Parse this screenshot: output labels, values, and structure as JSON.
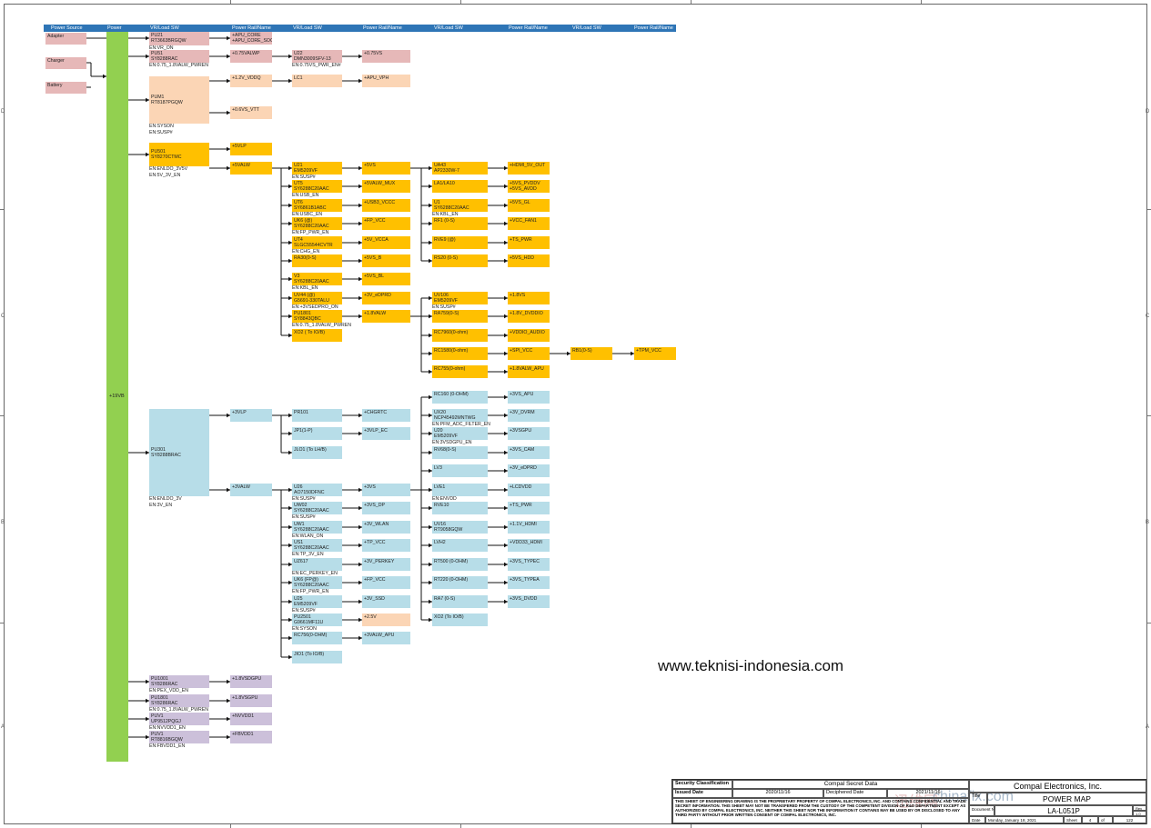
{
  "header": {
    "columns": [
      "Power Source",
      "Power",
      "VR/Load SW",
      "Power Rail/Name",
      "VR/Load SW",
      "Power Rail/Name",
      "VR/Load SW",
      "Power Rail/Name",
      "VR/Load SW",
      "Power Rail/Name"
    ]
  },
  "sources": [
    "Adapter",
    "Charger",
    "Battery"
  ],
  "main_rail": "+19VB",
  "zones": {
    "left": [
      "D",
      "C",
      "B",
      "A"
    ],
    "right": [
      "D",
      "C",
      "B",
      "A"
    ]
  },
  "boxes": [
    {
      "id": "pu21",
      "color": "pink",
      "lines": [
        "PU21",
        "RT3663BRGQW"
      ],
      "sub": [
        "EN:VR_ON"
      ]
    },
    {
      "id": "apu_core",
      "color": "pink",
      "lines": [
        "+APU_CORE",
        "+APU_CORE_SOC"
      ]
    },
    {
      "id": "pu51",
      "color": "pink",
      "lines": [
        "PU51",
        "SY8288RAC"
      ],
      "sub": [
        "EN:0.75_1.8VALW_PWREN"
      ]
    },
    {
      "id": "v075alwp",
      "color": "pink",
      "lines": [
        "+0.75VALWP"
      ]
    },
    {
      "id": "u22",
      "color": "pink",
      "lines": [
        "U22",
        "DMN3009SFV-13"
      ],
      "sub": [
        "EN:0.75VS_PWR_EN#"
      ]
    },
    {
      "id": "v075s",
      "color": "pink",
      "lines": [
        "+0.75VS"
      ]
    },
    {
      "id": "pum1",
      "color": "peach",
      "lines": [
        "PUM1",
        "RT8187PGQW"
      ],
      "sub": [
        "EN:SYSON",
        "EN:SUSP#"
      ]
    },
    {
      "id": "v12vddq",
      "color": "peach",
      "lines": [
        "+1.2V_VDDQ"
      ]
    },
    {
      "id": "lc1",
      "color": "peach",
      "lines": [
        "LC1"
      ]
    },
    {
      "id": "apu_vph",
      "color": "peach",
      "lines": [
        "+APU_VPH"
      ]
    },
    {
      "id": "v06vtt",
      "color": "peach",
      "lines": [
        "+0.6VS_VTT"
      ]
    },
    {
      "id": "pu501",
      "color": "orange",
      "lines": [
        "PU501",
        "SY8270CTMC"
      ],
      "sub": [
        "EN:ENLDO_3V5V",
        "EN:5V_3V_EN"
      ]
    },
    {
      "id": "v5vlp",
      "color": "orange",
      "lines": [
        "+5VLP"
      ]
    },
    {
      "id": "v5valw",
      "color": "orange",
      "lines": [
        "+5VALW"
      ]
    },
    {
      "id": "u21",
      "color": "orange",
      "lines": [
        "U21",
        "EM5209VF"
      ],
      "sub": [
        "EN:SUSP#"
      ]
    },
    {
      "id": "ut5",
      "color": "orange",
      "lines": [
        "UT5",
        "SY6288C20AAC"
      ],
      "sub": [
        "EN:USB_EN"
      ]
    },
    {
      "id": "ut6",
      "color": "orange",
      "lines": [
        "UT6",
        "SY6861B1ABC"
      ],
      "sub": [
        "EN:USBC_EN"
      ]
    },
    {
      "id": "uk6",
      "color": "orange",
      "lines": [
        "UK6 (@)",
        "SY6288C20AAC"
      ],
      "sub": [
        "EN:FP_PWR_EN"
      ]
    },
    {
      "id": "ut4",
      "color": "orange",
      "lines": [
        "UT4",
        "SLGC55544CVTR"
      ],
      "sub": [
        "EN:CHG_EN"
      ]
    },
    {
      "id": "ra30",
      "color": "orange",
      "lines": [
        "RA30(0-S)"
      ]
    },
    {
      "id": "v3",
      "color": "orange",
      "lines": [
        "V3",
        "SY6288C20AAC"
      ],
      "sub": [
        "EN:KBL_EN"
      ]
    },
    {
      "id": "uv44",
      "color": "orange",
      "lines": [
        "UV44 (@)",
        "G5691-330TALU"
      ],
      "sub": [
        "EN:+3VSEDPRO_ON"
      ]
    },
    {
      "id": "pu1801",
      "color": "orange",
      "lines": [
        "PU1801",
        "SY8843QBC"
      ],
      "sub": [
        "EN:0.75_1.8VALW_PWREN"
      ]
    },
    {
      "id": "xo2a",
      "color": "orange",
      "lines": [
        "XO2 ( To IO/B)"
      ]
    },
    {
      "id": "v5vs",
      "color": "orange",
      "lines": [
        "+5VS"
      ]
    },
    {
      "id": "v5valw_mux",
      "color": "orange",
      "lines": [
        "+5VALW_MUX"
      ]
    },
    {
      "id": "usb3_vccc",
      "color": "orange",
      "lines": [
        "+USB3_VCCC"
      ]
    },
    {
      "id": "fp_vcc_a",
      "color": "orange",
      "lines": [
        "+FP_VCC"
      ]
    },
    {
      "id": "v5v_vcca",
      "color": "orange",
      "lines": [
        "+5V_VCCA"
      ]
    },
    {
      "id": "v5vpb",
      "color": "orange",
      "lines": [
        "+5VS_B"
      ]
    },
    {
      "id": "v5vs_bl",
      "color": "orange",
      "lines": [
        "+5VS_BL"
      ]
    },
    {
      "id": "v3edprd",
      "color": "orange",
      "lines": [
        "+3V_eDPRD"
      ]
    },
    {
      "id": "v18valw",
      "color": "orange",
      "lines": [
        "+1.8VALW"
      ]
    },
    {
      "id": "ua43",
      "color": "orange",
      "lines": [
        "UA43",
        "AP2330W-7"
      ]
    },
    {
      "id": "la1",
      "color": "orange",
      "lines": [
        "LA1/LA10"
      ]
    },
    {
      "id": "u1",
      "color": "orange",
      "lines": [
        "U1",
        "SY6288C20AAC"
      ],
      "sub": [
        "EN:KBL_EN"
      ]
    },
    {
      "id": "rf1",
      "color": "orange",
      "lines": [
        "RF1 (0-S)"
      ]
    },
    {
      "id": "rve9",
      "color": "orange",
      "lines": [
        "RVE9 (@)"
      ]
    },
    {
      "id": "rs20",
      "color": "orange",
      "lines": [
        "RS20 (0-S)"
      ]
    },
    {
      "id": "hdmi_out",
      "color": "orange",
      "lines": [
        "+HDMI_5V_OUT"
      ]
    },
    {
      "id": "pvddv",
      "color": "orange",
      "lines": [
        "+5VS_PVDDV",
        "+5VS_AVDD"
      ]
    },
    {
      "id": "v5vs_gl",
      "color": "orange",
      "lines": [
        "+5VS_GL"
      ]
    },
    {
      "id": "vcc_fan1",
      "color": "orange",
      "lines": [
        "+VCC_FAN1"
      ]
    },
    {
      "id": "ts_pwr_a",
      "color": "orange",
      "lines": [
        "+TS_PWR"
      ]
    },
    {
      "id": "v5vs_hdd",
      "color": "orange",
      "lines": [
        "+5VS_HDD"
      ]
    },
    {
      "id": "uv106",
      "color": "orange",
      "lines": [
        "UV106",
        "EM5209VF"
      ],
      "sub": [
        "EN:SUSP#"
      ]
    },
    {
      "id": "ra759",
      "color": "orange",
      "lines": [
        "RA759(0-S)"
      ]
    },
    {
      "id": "rc7960",
      "color": "orange",
      "lines": [
        "RC7960(0-ohm)"
      ]
    },
    {
      "id": "rc1580",
      "color": "orange",
      "lines": [
        "RC1580(0-ohm)"
      ]
    },
    {
      "id": "rc755",
      "color": "orange",
      "lines": [
        "RC755(0-ohm)"
      ]
    },
    {
      "id": "v18vs",
      "color": "orange",
      "lines": [
        "+1.8VS"
      ]
    },
    {
      "id": "dvddio",
      "color": "orange",
      "lines": [
        "+1.8V_DVDDIO"
      ]
    },
    {
      "id": "vddio_audio",
      "color": "orange",
      "lines": [
        "+VDDIO_AUDIO"
      ]
    },
    {
      "id": "spi_vcc",
      "color": "orange",
      "lines": [
        "+SPI_VCC"
      ]
    },
    {
      "id": "rb1",
      "color": "orange",
      "lines": [
        "RB1(0-S)"
      ]
    },
    {
      "id": "tpm_vcc",
      "color": "orange",
      "lines": [
        "+TPM_VCC"
      ]
    },
    {
      "id": "valw_apu18",
      "color": "orange",
      "lines": [
        "+1.8VALW_APU"
      ]
    },
    {
      "id": "pu301",
      "color": "blue",
      "lines": [
        "PU301",
        "SY8288BRAC"
      ],
      "sub": [
        "EN:ENLDO_3V",
        "EN:3V_EN"
      ]
    },
    {
      "id": "v3vlp",
      "color": "blue",
      "lines": [
        "+3VLP"
      ]
    },
    {
      "id": "v3valw",
      "color": "blue",
      "lines": [
        "+3VALW"
      ]
    },
    {
      "id": "pr101",
      "color": "blue",
      "lines": [
        "PR101"
      ]
    },
    {
      "id": "jp1",
      "color": "blue",
      "lines": [
        "JP1(1-P)"
      ]
    },
    {
      "id": "jlo1",
      "color": "blue",
      "lines": [
        "JLO1 (To LH/B)"
      ]
    },
    {
      "id": "chgrtc",
      "color": "blue",
      "lines": [
        "+CHGRTC"
      ]
    },
    {
      "id": "v3vlp_ec",
      "color": "blue",
      "lines": [
        "+3VLP_EC"
      ]
    },
    {
      "id": "rc160",
      "color": "blue",
      "lines": [
        "RC160 (0-OHM)"
      ]
    },
    {
      "id": "ux20",
      "color": "blue",
      "lines": [
        "UX20",
        "NCP45492MNTWG"
      ],
      "sub": [
        "EN:PFM_ADC_FILTER_EN"
      ]
    },
    {
      "id": "u20",
      "color": "blue",
      "lines": [
        "U20",
        "EM5209VF"
      ],
      "sub": [
        "EN:3VSDGPU_EN"
      ]
    },
    {
      "id": "rv68",
      "color": "blue",
      "lines": [
        "RV68(0-S)"
      ]
    },
    {
      "id": "lv3",
      "color": "blue",
      "lines": [
        "LV3"
      ]
    },
    {
      "id": "v3vs_apu",
      "color": "blue",
      "lines": [
        "+3VS_APU"
      ]
    },
    {
      "id": "v3_dvrm",
      "color": "blue",
      "lines": [
        "+3V_DVRM"
      ]
    },
    {
      "id": "v3vsgpu",
      "color": "blue",
      "lines": [
        "+3VSGPU"
      ]
    },
    {
      "id": "v3vs_cam",
      "color": "blue",
      "lines": [
        "+3VS_CAM"
      ]
    },
    {
      "id": "v3_edprd",
      "color": "blue",
      "lines": [
        "+3V_eDPRD"
      ]
    },
    {
      "id": "u26",
      "color": "blue",
      "lines": [
        "U26",
        "AO7150DFNC"
      ],
      "sub": [
        "EN:SUSP#"
      ]
    },
    {
      "id": "uw02",
      "color": "blue",
      "lines": [
        "UW02",
        "SY6288C20AAC"
      ],
      "sub": [
        "EN:SUSP#"
      ]
    },
    {
      "id": "uw1",
      "color": "blue",
      "lines": [
        "UW1",
        "SY6288C20AAC"
      ],
      "sub": [
        "EN:WLAN_ON"
      ]
    },
    {
      "id": "us1",
      "color": "blue",
      "lines": [
        "US1",
        "SY6288C20AAC"
      ],
      "sub": [
        "EN:TP_3V_EN"
      ]
    },
    {
      "id": "uz617",
      "color": "blue",
      "lines": [
        "UZ617"
      ],
      "sub": [
        "EN:EC_PERKEY_EN"
      ]
    },
    {
      "id": "uk6b",
      "color": "blue",
      "lines": [
        "UK6 (FP@)",
        "SY6288C20AAC"
      ],
      "sub": [
        "EN:FP_PWR_EN"
      ]
    },
    {
      "id": "u25",
      "color": "blue",
      "lines": [
        "U25",
        "EM5209VF"
      ],
      "sub": [
        "EN:SUSP#"
      ]
    },
    {
      "id": "pu2501",
      "color": "blue",
      "lines": [
        "PU2501",
        "G9661MF11U"
      ],
      "sub": [
        "EN:SYSON"
      ]
    },
    {
      "id": "rc756",
      "color": "blue",
      "lines": [
        "RC756(0-OHM)"
      ]
    },
    {
      "id": "jio1",
      "color": "blue",
      "lines": [
        "JIO1 (To IO/B)"
      ]
    },
    {
      "id": "v3vs",
      "color": "blue",
      "lines": [
        "+3VS"
      ]
    },
    {
      "id": "v3vs_dp",
      "color": "blue",
      "lines": [
        "+3VS_DP"
      ]
    },
    {
      "id": "v3_wlan",
      "color": "blue",
      "lines": [
        "+3V_WLAN"
      ]
    },
    {
      "id": "tp_vcc",
      "color": "blue",
      "lines": [
        "+TP_VCC"
      ]
    },
    {
      "id": "v3_perkey",
      "color": "blue",
      "lines": [
        "+3V_PERKEY"
      ]
    },
    {
      "id": "fp_vcc_b",
      "color": "blue",
      "lines": [
        "+FP_VCC"
      ]
    },
    {
      "id": "v3_ssd",
      "color": "blue",
      "lines": [
        "+3V_SSD"
      ]
    },
    {
      "id": "v25v",
      "color": "peach",
      "lines": [
        "+2.5V"
      ]
    },
    {
      "id": "v3valw_apu",
      "color": "blue",
      "lines": [
        "+3VALW_APU"
      ]
    },
    {
      "id": "lve1",
      "color": "blue",
      "lines": [
        "LVE1"
      ],
      "sub": [
        "EN:ENVDD"
      ]
    },
    {
      "id": "rve10",
      "color": "blue",
      "lines": [
        "RVE10"
      ]
    },
    {
      "id": "uv16",
      "color": "blue",
      "lines": [
        "UV16",
        "RT9058GQW"
      ]
    },
    {
      "id": "lvh2",
      "color": "blue",
      "lines": [
        "LVH2"
      ]
    },
    {
      "id": "rt500",
      "color": "blue",
      "lines": [
        "RT500 (0-OHM)"
      ]
    },
    {
      "id": "rt220",
      "color": "blue",
      "lines": [
        "RT220 (0-OHM)"
      ]
    },
    {
      "id": "ra7",
      "color": "blue",
      "lines": [
        "RA7 (0-S)"
      ]
    },
    {
      "id": "xo2b",
      "color": "blue",
      "lines": [
        "XO2 (To IO/B)"
      ]
    },
    {
      "id": "lcdvdd",
      "color": "blue",
      "lines": [
        "+LCDVDD"
      ]
    },
    {
      "id": "ts_pwr_b",
      "color": "blue",
      "lines": [
        "+TS_PWR"
      ]
    },
    {
      "id": "v11_hdmi",
      "color": "blue",
      "lines": [
        "+1.1V_HDMI"
      ]
    },
    {
      "id": "vdd33_hdmi",
      "color": "blue",
      "lines": [
        "+VDD33_HDMI"
      ]
    },
    {
      "id": "tppc",
      "color": "blue",
      "lines": [
        "+3VS_TYPEC"
      ]
    },
    {
      "id": "tpea",
      "color": "blue",
      "lines": [
        "+3VS_TYPEA"
      ]
    },
    {
      "id": "dvdd",
      "color": "blue",
      "lines": [
        "+3VS_DVDD"
      ]
    },
    {
      "id": "pu1001",
      "color": "purple",
      "lines": [
        "PU1001",
        "SY8286RAC"
      ],
      "sub": [
        "EN:PEX_VDD_EN"
      ]
    },
    {
      "id": "v18vsdgpu",
      "color": "purple",
      "lines": [
        "+1.8VSDGPU"
      ]
    },
    {
      "id": "pu1801b",
      "color": "purple",
      "lines": [
        "PU1801",
        "SY8286RAC"
      ],
      "sub": [
        "EN:0.75_1.8VALW_PWREN"
      ]
    },
    {
      "id": "v18vsgpu",
      "color": "purple",
      "lines": [
        "+1.8VSGPU"
      ]
    },
    {
      "id": "puv1",
      "color": "purple",
      "lines": [
        "PUV1",
        "UP9512PQGJ"
      ],
      "sub": [
        "EN:NVVDD1_EN"
      ]
    },
    {
      "id": "nvvdd1",
      "color": "purple",
      "lines": [
        "+NVVDD1"
      ]
    },
    {
      "id": "puv1b",
      "color": "purple",
      "lines": [
        "PUV1",
        "RT8816BGQW"
      ],
      "sub": [
        "EN:FBVDD1_EN"
      ]
    },
    {
      "id": "fbvdd1",
      "color": "purple",
      "lines": [
        "+FBVDD1"
      ]
    }
  ],
  "watermark": "www.teknisi-indonesia.com",
  "title_block": {
    "security_classification_label": "Security Classification",
    "security_classification": "Compal Secret Data",
    "issued_label": "Issued Date",
    "issued_date": "2020/11/16",
    "deciphered_label": "Deciphered Date",
    "deciphered_date": "2021/11/16",
    "company": "Compal Electronics, Inc.",
    "title_label": "Title",
    "title": "POWER MAP",
    "document_number_label": "Document Number",
    "document_number": "LA-L051P",
    "rev_label": "Rev",
    "rev": "1.0",
    "notice": "THIS SHEET OF ENGINEERING DRAWING IS THE PROPRIETARY PROPERTY OF COMPAL ELECTRONICS, INC. AND CONTAINS CONFIDENTIAL AND TRADE SECRET INFORMATION. THIS SHEET MAY NOT BE TRANSFERED FROM THE CUSTODY OF THE COMPETENT DIVISION OF R&D DEPARTMENT EXCEPT AS AUTHORIZED BY COMPAL ELECTRONICS, INC. NEITHER THIS SHEET NOR THE INFORMATION IT CONTAINS MAY BE USED BY OR DISCLOSED TO ANY THIRD PARTY WITHOUT PRIOR WRITTEN CONSENT OF COMPAL ELECTRONICS, INC.",
    "date_label": "Date",
    "date": "Monday, January 18, 2021",
    "sheet_label": "Sheet",
    "sheet": "4",
    "of_label": "of",
    "of": "122"
  },
  "site_mark": "chinafix.com",
  "site_mark_cn": "迅维网"
}
